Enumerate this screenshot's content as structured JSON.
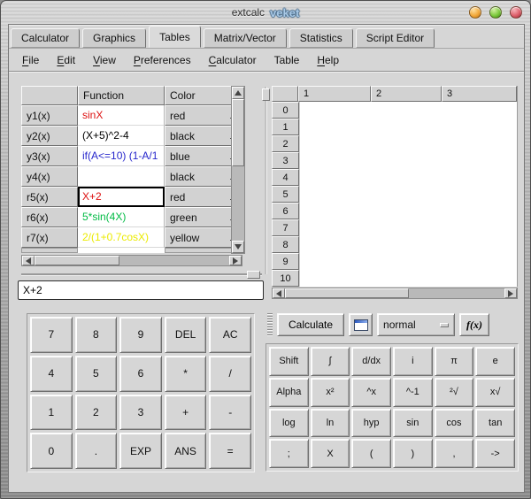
{
  "window": {
    "title": "extcalc",
    "brand": "veket"
  },
  "tabs": [
    {
      "label": "Calculator",
      "active": false
    },
    {
      "label": "Graphics",
      "active": false
    },
    {
      "label": "Tables",
      "active": true
    },
    {
      "label": "Matrix/Vector",
      "active": false
    },
    {
      "label": "Statistics",
      "active": false
    },
    {
      "label": "Script Editor",
      "active": false
    }
  ],
  "menus": [
    {
      "label": "File",
      "underline_first": true
    },
    {
      "label": "Edit",
      "underline_first": true
    },
    {
      "label": "View",
      "underline_first": true
    },
    {
      "label": "Preferences",
      "underline_first": true
    },
    {
      "label": "Calculator",
      "underline_first": true
    },
    {
      "label": "Table",
      "underline_first": false
    },
    {
      "label": "Help",
      "underline_first": true
    }
  ],
  "function_table": {
    "columns": [
      "",
      "Function",
      "Color"
    ],
    "rows": [
      {
        "name": "y1(x)",
        "function": "sinX",
        "color_name": "red",
        "color": "#dd1111",
        "selected": false
      },
      {
        "name": "y2(x)",
        "function": "(X+5)^2-4",
        "color_name": "black",
        "color": "#000000",
        "selected": false
      },
      {
        "name": "y3(x)",
        "function": "if(A<=10) (1-A/1",
        "color_name": "blue",
        "color": "#2626cc",
        "selected": false
      },
      {
        "name": "y4(x)",
        "function": "",
        "color_name": "black",
        "color": "#000000",
        "selected": false
      },
      {
        "name": "r5(x)",
        "function": "X+2",
        "color_name": "red",
        "color": "#dd1111",
        "selected": true
      },
      {
        "name": "r6(x)",
        "function": "5*sin(4X)",
        "color_name": "green",
        "color": "#00bb44",
        "selected": false
      },
      {
        "name": "r7(x)",
        "function": "2/(1+0.7cosX)",
        "color_name": "yellow",
        "color": "#ebeb00",
        "selected": false
      }
    ]
  },
  "expression_input": {
    "value": "X+2"
  },
  "spreadsheet": {
    "column_headers": [
      "1",
      "2",
      "3"
    ],
    "row_headers": [
      "0",
      "1",
      "2",
      "3",
      "4",
      "5",
      "6",
      "7",
      "8",
      "9",
      "10"
    ]
  },
  "toolbar": {
    "calculate_label": "Calculate",
    "icon_button": "window-icon",
    "mode_value": "normal",
    "fx_label": "f(x)"
  },
  "keypad_left": {
    "rows": [
      [
        "7",
        "8",
        "9",
        "DEL",
        "AC"
      ],
      [
        "4",
        "5",
        "6",
        "*",
        "/"
      ],
      [
        "1",
        "2",
        "3",
        "+",
        "-"
      ],
      [
        "0",
        ".",
        "EXP",
        "ANS",
        "="
      ]
    ]
  },
  "keypad_right": {
    "rows": [
      [
        "Shift",
        "∫",
        "d/dx",
        "i",
        "π",
        "e"
      ],
      [
        "Alpha",
        "x²",
        "^x",
        "^-1",
        "²√",
        "x√"
      ],
      [
        "log",
        "ln",
        "hyp",
        "sin",
        "cos",
        "tan"
      ],
      [
        ";",
        "X",
        "(",
        ")",
        ",",
        "->"
      ]
    ]
  }
}
